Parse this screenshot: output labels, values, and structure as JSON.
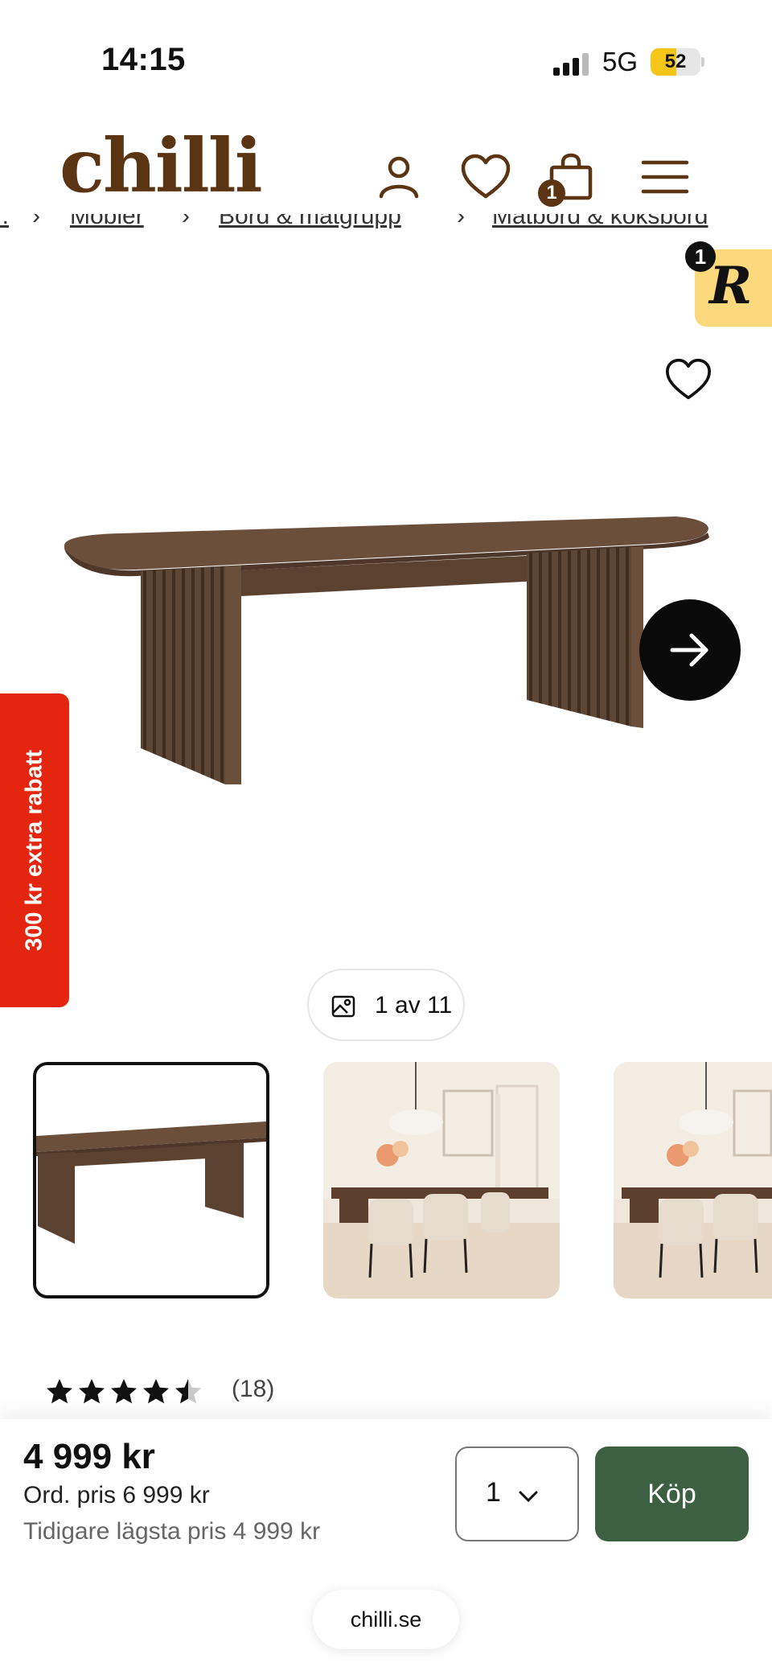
{
  "status_bar": {
    "time": "14:15",
    "network": "5G",
    "battery": "52",
    "battery_level": 0.52
  },
  "header": {
    "logo": "chilli",
    "icons": [
      "user-icon",
      "heart-icon",
      "bag-icon",
      "menu-icon"
    ],
    "cart_count": "1"
  },
  "breadcrumb": [
    "...",
    "Möbler",
    "Bord & matgrupp",
    "Matbord & köksbord"
  ],
  "rewards": {
    "badge": "1",
    "letter": "R"
  },
  "gallery": {
    "counter": "1 av 11"
  },
  "promo": {
    "label": "300 kr extra rabatt"
  },
  "rating": {
    "stars": 4.5,
    "count": "(18)"
  },
  "purchase": {
    "price": "4 999 kr",
    "ordinary_price": "Ord. pris 6 999 kr",
    "lowest_price": "Tidigare lägsta pris 4 999 kr",
    "quantity": "1",
    "buy_label": "Köp"
  },
  "browser": {
    "domain": "chilli.se"
  },
  "colors": {
    "brand": "#5b3413",
    "buy": "#3d6042",
    "promo": "#e4250f",
    "rewards": "#fcd97c"
  }
}
